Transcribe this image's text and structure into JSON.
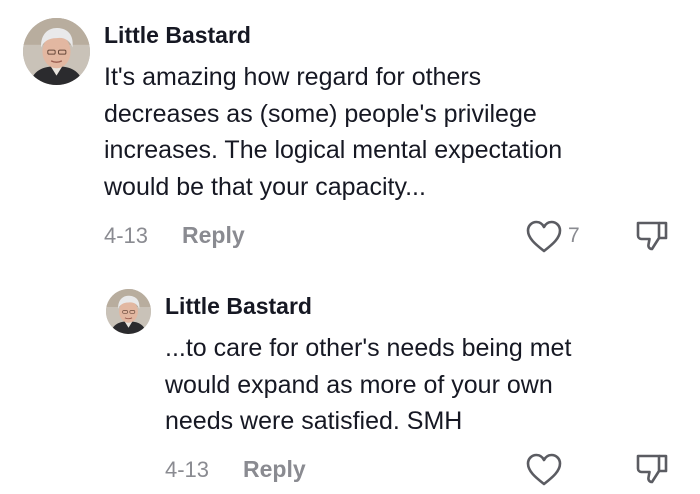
{
  "comments": [
    {
      "username": "Little Bastard",
      "text_lines": [
        "It's amazing how regard for others",
        "decreases as (some) people's privilege",
        "increases. The logical mental expectation",
        "would be that your capacity..."
      ],
      "date": "4-13",
      "reply_label": "Reply",
      "like_count": "7",
      "icons": {
        "like": "heart-outline-icon",
        "dislike": "thumbs-down-outline-icon"
      }
    },
    {
      "username": "Little Bastard",
      "text_lines": [
        "...to care for other's needs being met",
        "would expand as more of your own",
        "needs were satisfied. SMH"
      ],
      "date": "4-13",
      "reply_label": "Reply",
      "like_count": "",
      "icons": {
        "like": "heart-outline-icon",
        "dislike": "thumbs-down-outline-icon"
      }
    }
  ],
  "colors": {
    "primary_text": "#161823",
    "secondary_text": "#8a8b91",
    "icon_stroke": "#5b5c62",
    "background": "#ffffff"
  }
}
